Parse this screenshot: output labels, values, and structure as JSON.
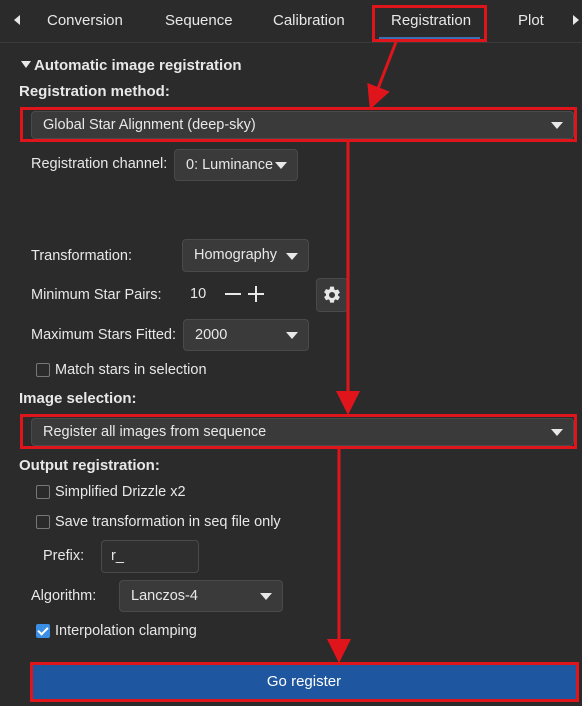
{
  "tabs": [
    "Conversion",
    "Sequence",
    "Calibration",
    "Registration",
    "Plot"
  ],
  "auto_title": "Automatic image registration",
  "method_label": "Registration method:",
  "method_value": "Global Star Alignment (deep-sky)",
  "channel_label": "Registration channel:",
  "channel_value": "0: Luminance",
  "transformation_label": "Transformation:",
  "transformation_value": "Homography",
  "min_pairs_label": "Minimum Star Pairs:",
  "min_pairs_value": "10",
  "max_stars_label": "Maximum Stars Fitted:",
  "max_stars_value": "2000",
  "match_label": "Match stars in selection",
  "image_selection_label": "Image selection:",
  "image_selection_value": "Register all images from sequence",
  "output_title": "Output registration:",
  "drizzle_label": "Simplified Drizzle x2",
  "save_transform_label": "Save transformation in seq file only",
  "prefix_label": "Prefix:",
  "prefix_value": "r_",
  "algorithm_label": "Algorithm:",
  "algorithm_value": "Lanczos-4",
  "clamping_label": "Interpolation clamping",
  "go_label": "Go register",
  "icons": [
    "chevron-left-icon",
    "chevron-right-icon",
    "triangle-down-icon",
    "minus-icon",
    "plus-icon",
    "gear-icon",
    "check-icon"
  ],
  "colors": {
    "accent": "#1e56a0",
    "annotation": "#e0151c",
    "checkbox": "#3a8ee6"
  },
  "checks": {
    "match": false,
    "drizzle": false,
    "save_transform": false,
    "clamping": true
  }
}
